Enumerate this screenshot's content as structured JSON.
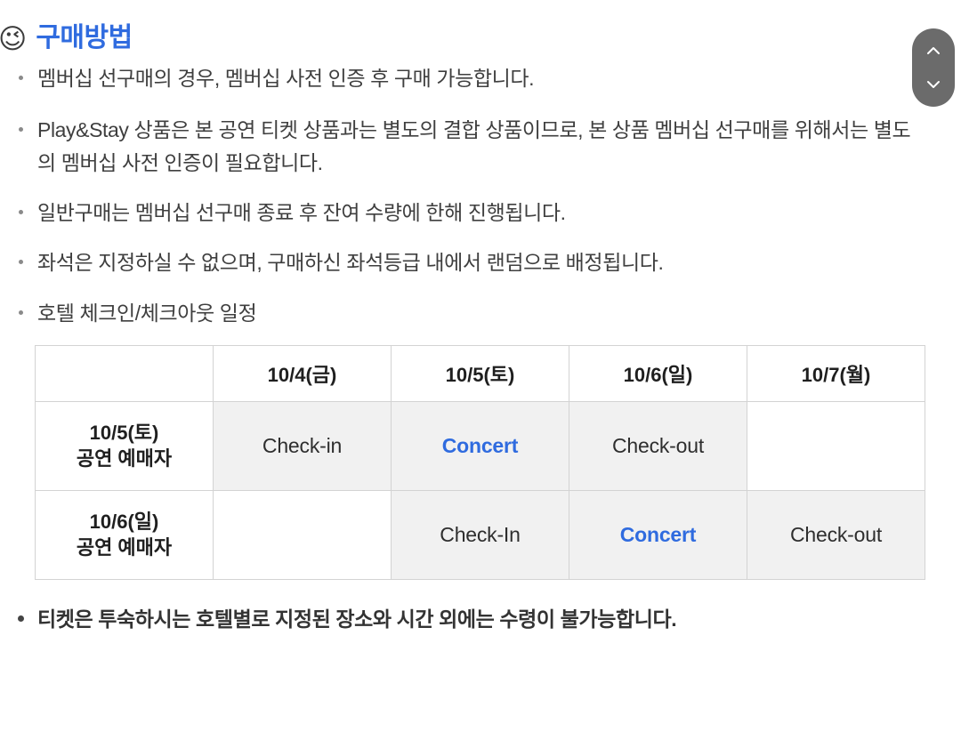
{
  "header": {
    "emoji": "😉",
    "emoji_name": "winking-face-emoji",
    "title": "구매방법",
    "title_color": "#2f6bdf"
  },
  "scroll_control": {
    "up_label": "위로 스크롤",
    "down_label": "아래로 스크롤",
    "background_color": "#6b6b6b"
  },
  "notices": [
    {
      "text": "멤버십 선구매의 경우, 멤버십 사전 인증 후 구매 가능합니다.",
      "emphasis": false
    },
    {
      "text": "Play&Stay 상품은 본 공연 티켓 상품과는 별도의 결합 상품이므로, 본 상품 멤버십 선구매를 위해서는 별도의 멤버십 사전 인증이 필요합니다.",
      "emphasis": false
    },
    {
      "text": "일반구매는 멤버십 선구매 종료 후 잔여 수량에 한해 진행됩니다.",
      "emphasis": false
    },
    {
      "text": "좌석은 지정하실 수 없으며, 구매하신 좌석등급 내에서 랜덤으로 배정됩니다.",
      "emphasis": false
    },
    {
      "text": "호텔 체크인/체크아웃 일정",
      "emphasis": false
    }
  ],
  "footer_notice": {
    "text": "티켓은 투숙하시는 호텔별로 지정된 장소와 시간 외에는 수령이 불가능합니다.",
    "emphasis": true
  },
  "schedule_table": {
    "columns": [
      "",
      "10/4(금)",
      "10/5(토)",
      "10/6(일)",
      "10/7(월)"
    ],
    "rows": [
      {
        "label": "10/5(토)\n공연 예매자",
        "cells": [
          {
            "text": "Check-in",
            "type": "normal"
          },
          {
            "text": "Concert",
            "type": "concert"
          },
          {
            "text": "Check-out",
            "type": "normal"
          },
          {
            "text": "",
            "type": "empty"
          }
        ]
      },
      {
        "label": "10/6(일)\n공연 예매자",
        "cells": [
          {
            "text": "",
            "type": "empty"
          },
          {
            "text": "Check-In",
            "type": "normal"
          },
          {
            "text": "Concert",
            "type": "concert"
          },
          {
            "text": "Check-out",
            "type": "normal"
          }
        ]
      }
    ],
    "concert_color": "#2f6bdf",
    "filled_cell_color": "#f1f1f1",
    "border_color": "#d3d3d3"
  }
}
